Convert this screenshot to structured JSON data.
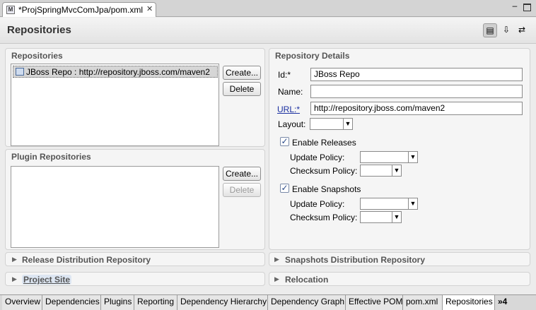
{
  "editor_tab": {
    "title": "*ProjSpringMvcComJpa/pom.xml",
    "icon": "maven-pom-file-icon",
    "close": "✕"
  },
  "window": {
    "minimize": "–"
  },
  "header": {
    "title": "Repositories",
    "buttons": [
      "▤",
      "⇩",
      "⇄"
    ]
  },
  "repositories": {
    "title": "Repositories",
    "items": [
      {
        "label": "JBoss Repo : http://repository.jboss.com/maven2"
      }
    ],
    "create_label": "Create...",
    "delete_label": "Delete"
  },
  "plugin_repositories": {
    "title": "Plugin Repositories",
    "create_label": "Create...",
    "delete_label": "Delete"
  },
  "details": {
    "title": "Repository Details",
    "id_label": "Id:*",
    "id_value": "JBoss Repo",
    "name_label": "Name:",
    "name_value": "",
    "url_label": "URL:*",
    "url_value": "http://repository.jboss.com/maven2",
    "layout_label": "Layout:",
    "enable_releases": {
      "label": "Enable Releases",
      "checked": true
    },
    "releases_update_policy_label": "Update Policy:",
    "releases_checksum_policy_label": "Checksum Policy:",
    "enable_snapshots": {
      "label": "Enable Snapshots",
      "checked": true
    },
    "snapshots_update_policy_label": "Update Policy:",
    "snapshots_checksum_policy_label": "Checksum Policy:"
  },
  "collapsed_sections": {
    "release_distribution": "Release Distribution Repository",
    "snapshots_distribution": "Snapshots Distribution Repository",
    "project_site": "Project Site",
    "relocation": "Relocation"
  },
  "page_tabs": [
    "Overview",
    "Dependencies",
    "Plugins",
    "Reporting",
    "Dependency Hierarchy",
    "Dependency Graph",
    "Effective POM",
    "pom.xml",
    "Repositories"
  ],
  "page_tabs_active": "Repositories",
  "page_tabs_overflow": "»4",
  "colors": {
    "selection": "#d6d6d6",
    "link": "#1a2fa0",
    "section_title": "#555555"
  }
}
